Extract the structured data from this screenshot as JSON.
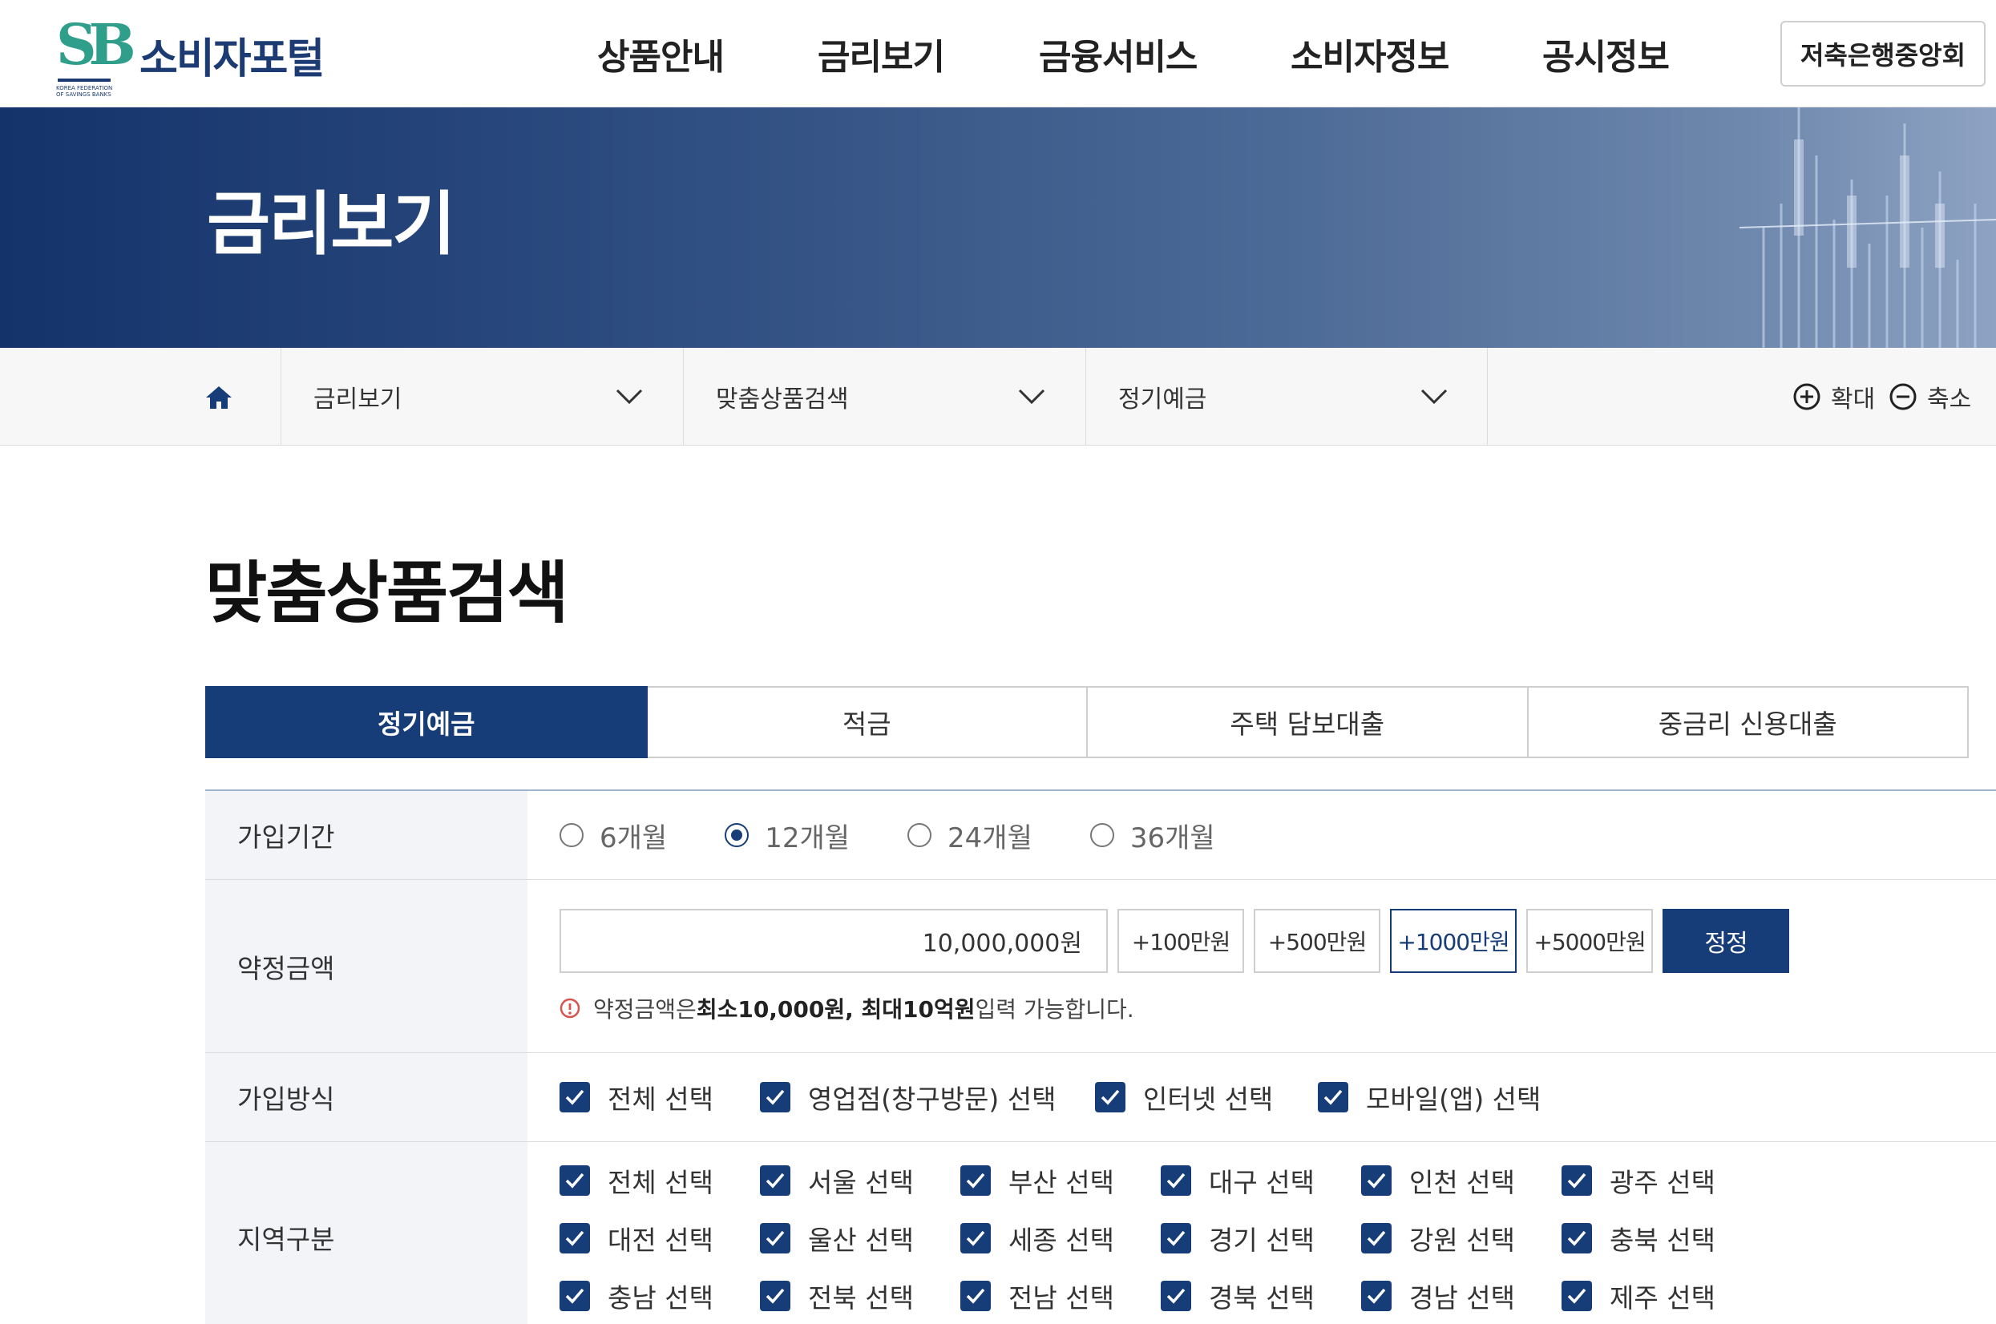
{
  "header": {
    "logo_text": "소비자포털",
    "logo_mark": "SB",
    "logo_sub": "KOREA FEDERATION OF SAVINGS BANKS",
    "nav": [
      "상품안내",
      "금리보기",
      "금융서비스",
      "소비자정보",
      "공시정보"
    ],
    "association_button": "저축은행중앙회"
  },
  "banner": {
    "title": "금리보기"
  },
  "breadcrumb": {
    "home_icon": "home-icon",
    "items": [
      "금리보기",
      "맞춤상품검색",
      "정기예금"
    ],
    "zoom_in": "확대",
    "zoom_out": "축소"
  },
  "page": {
    "title": "맞춤상품검색"
  },
  "tabs": [
    {
      "label": "정기예금",
      "active": true
    },
    {
      "label": "적금",
      "active": false
    },
    {
      "label": "주택 담보대출",
      "active": false
    },
    {
      "label": "중금리 신용대출",
      "active": false
    }
  ],
  "form": {
    "period": {
      "label": "가입기간",
      "options": [
        "6개월",
        "12개월",
        "24개월",
        "36개월"
      ],
      "selected": "12개월"
    },
    "amount": {
      "label": "약정금액",
      "value": "10,000,000원",
      "buttons": [
        "+100만원",
        "+500만원",
        "+1000만원",
        "+5000만원"
      ],
      "selected_button": "+1000만원",
      "reset": "정정",
      "notice_pre": "약정금액은 ",
      "notice_bold": "최소10,000원, 최대10억원",
      "notice_post": " 입력 가능합니다."
    },
    "method": {
      "label": "가입방식",
      "options": [
        "전체 선택",
        "영업점(창구방문) 선택",
        "인터넷 선택",
        "모바일(앱) 선택"
      ]
    },
    "region": {
      "label": "지역구분",
      "options": [
        "전체 선택",
        "서울 선택",
        "부산 선택",
        "대구 선택",
        "인천 선택",
        "광주 선택",
        "대전 선택",
        "울산 선택",
        "세종 선택",
        "경기 선택",
        "강원 선택",
        "충북 선택",
        "충남 선택",
        "전북 선택",
        "전남 선택",
        "경북 선택",
        "경남 선택",
        "제주 선택"
      ]
    }
  },
  "colors": {
    "brand_navy": "#173d78",
    "logo_green": "#2f9e8a",
    "label_bg": "#f2f4f8"
  }
}
